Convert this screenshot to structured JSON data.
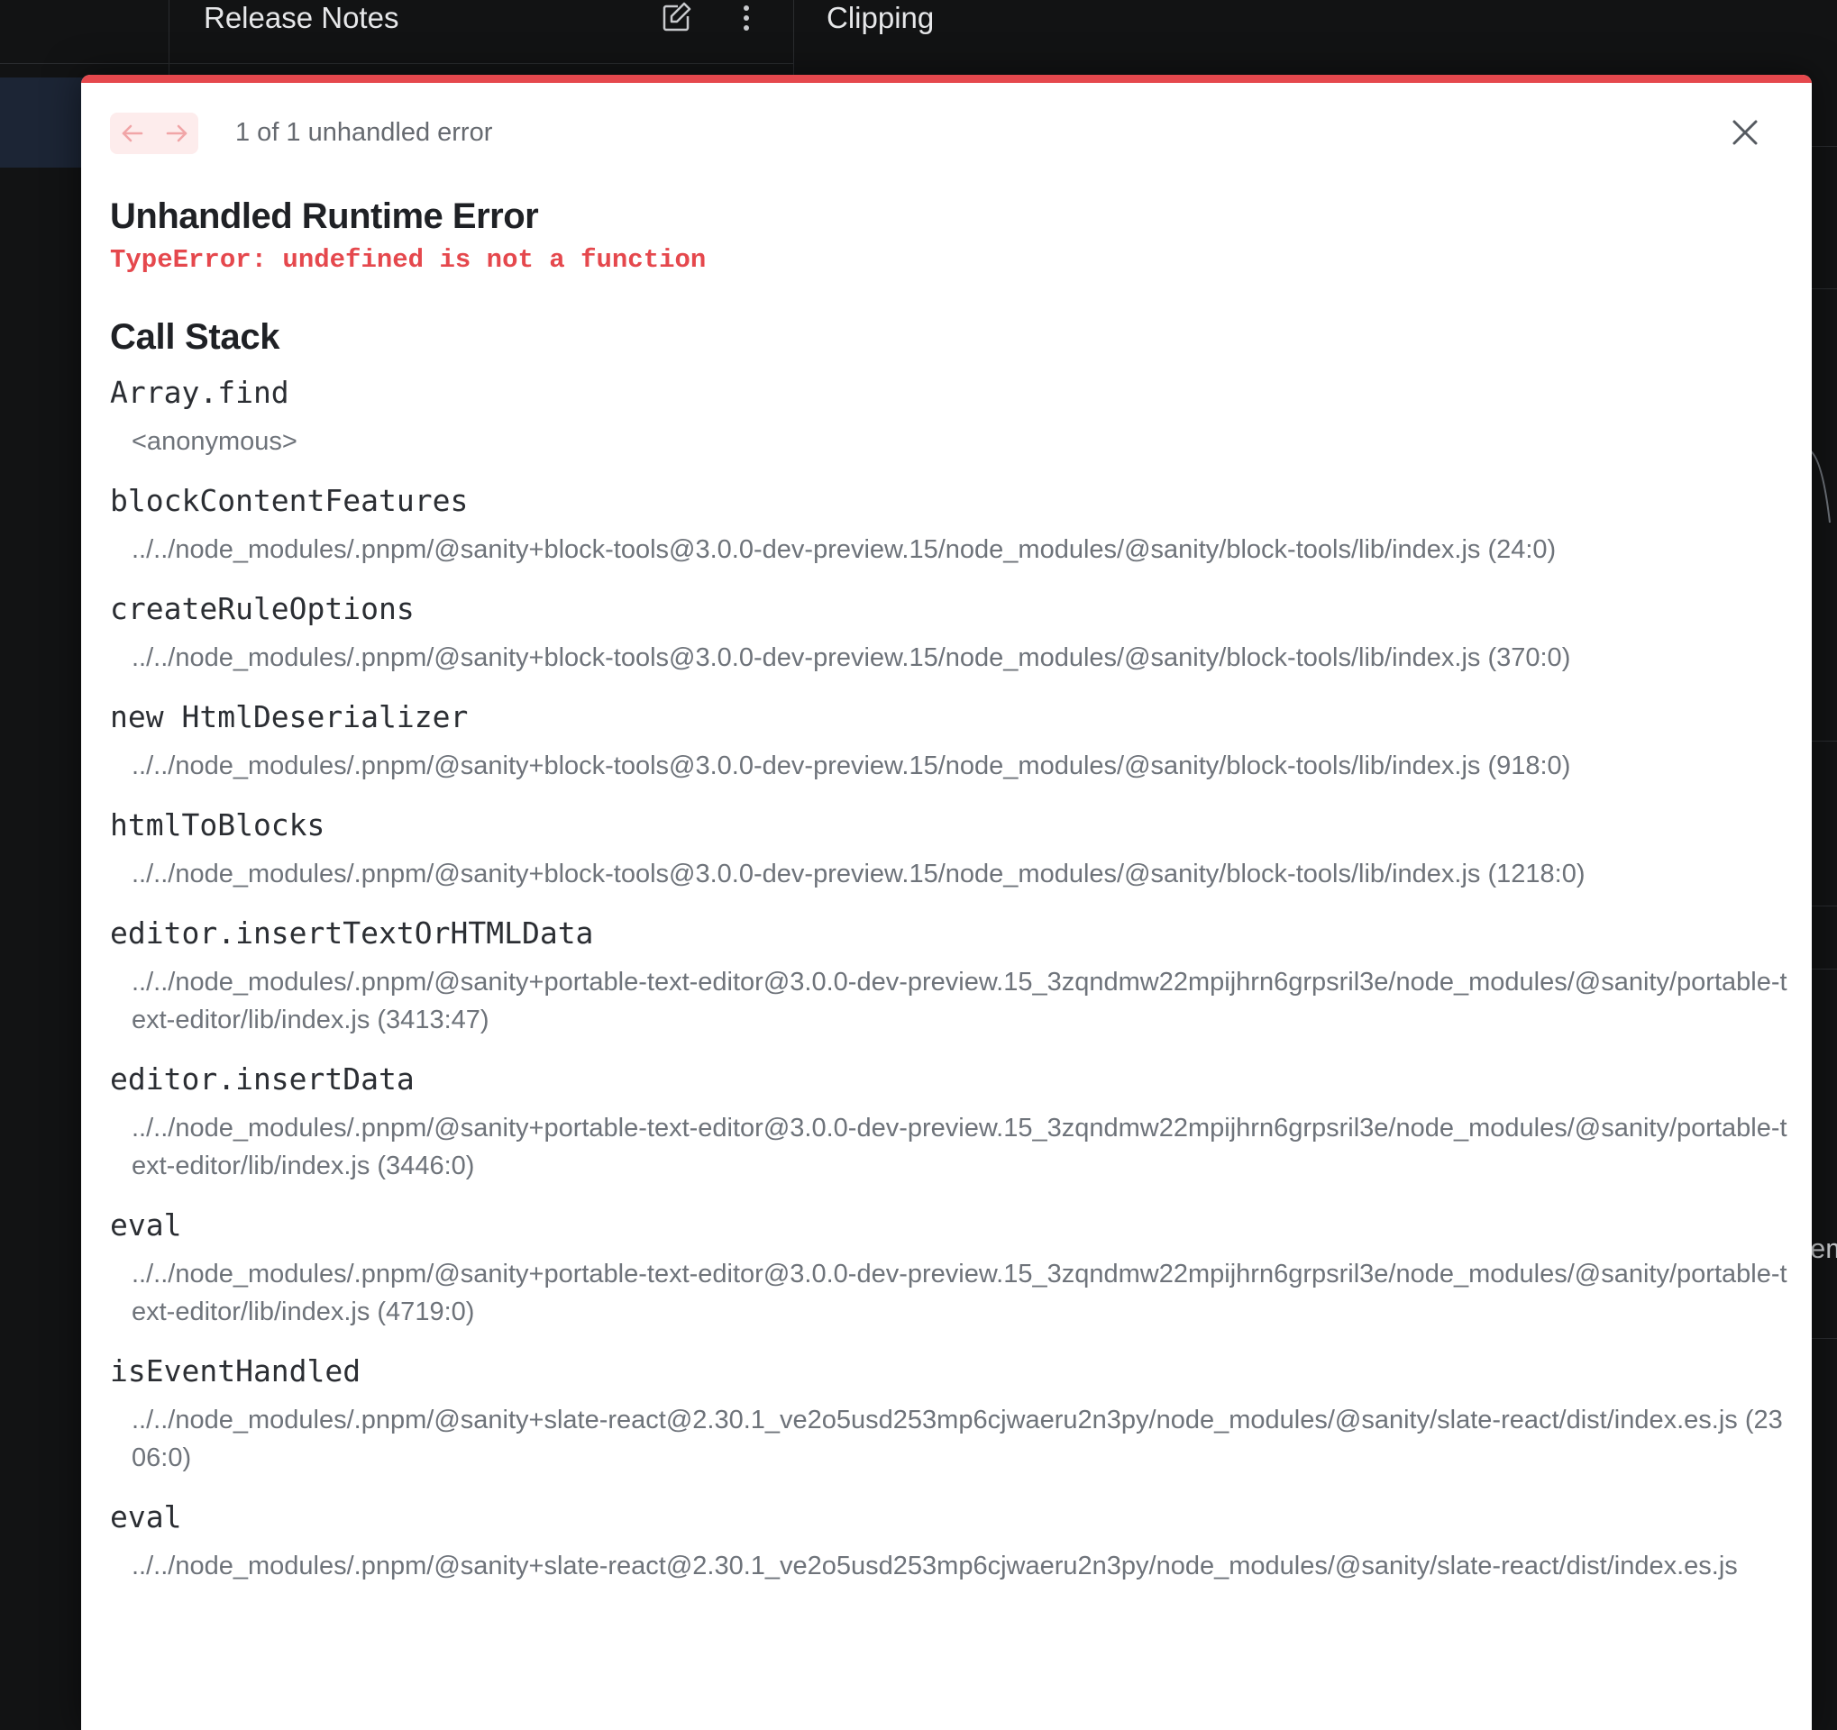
{
  "background": {
    "release_title": "Release Notes",
    "clipping_title": "Clipping",
    "peek_text": "em"
  },
  "modal": {
    "error_count": "1 of 1 unhandled error",
    "title": "Unhandled Runtime Error",
    "message": "TypeError: undefined is not a function",
    "callstack_title": "Call Stack",
    "accent_color": "#e5484d",
    "frames": [
      {
        "fn": "Array.find",
        "file": "<anonymous>"
      },
      {
        "fn": "blockContentFeatures",
        "file": "../../node_modules/.pnpm/@sanity+block-tools@3.0.0-dev-preview.15/node_modules/@sanity/block-tools/lib/index.js (24:0)"
      },
      {
        "fn": "createRuleOptions",
        "file": "../../node_modules/.pnpm/@sanity+block-tools@3.0.0-dev-preview.15/node_modules/@sanity/block-tools/lib/index.js (370:0)"
      },
      {
        "fn": "new HtmlDeserializer",
        "file": "../../node_modules/.pnpm/@sanity+block-tools@3.0.0-dev-preview.15/node_modules/@sanity/block-tools/lib/index.js (918:0)"
      },
      {
        "fn": "htmlToBlocks",
        "file": "../../node_modules/.pnpm/@sanity+block-tools@3.0.0-dev-preview.15/node_modules/@sanity/block-tools/lib/index.js (1218:0)"
      },
      {
        "fn": "editor.insertTextOrHTMLData",
        "file": "../../node_modules/.pnpm/@sanity+portable-text-editor@3.0.0-dev-preview.15_3zqndmw22mpijhrn6grpsril3e/node_modules/@sanity/portable-text-editor/lib/index.js (3413:47)"
      },
      {
        "fn": "editor.insertData",
        "file": "../../node_modules/.pnpm/@sanity+portable-text-editor@3.0.0-dev-preview.15_3zqndmw22mpijhrn6grpsril3e/node_modules/@sanity/portable-text-editor/lib/index.js (3446:0)"
      },
      {
        "fn": "eval",
        "file": "../../node_modules/.pnpm/@sanity+portable-text-editor@3.0.0-dev-preview.15_3zqndmw22mpijhrn6grpsril3e/node_modules/@sanity/portable-text-editor/lib/index.js (4719:0)"
      },
      {
        "fn": "isEventHandled",
        "file": "../../node_modules/.pnpm/@sanity+slate-react@2.30.1_ve2o5usd253mp6cjwaeru2n3py/node_modules/@sanity/slate-react/dist/index.es.js (2306:0)"
      },
      {
        "fn": "eval",
        "file": "../../node_modules/.pnpm/@sanity+slate-react@2.30.1_ve2o5usd253mp6cjwaeru2n3py/node_modules/@sanity/slate-react/dist/index.es.js"
      }
    ]
  }
}
